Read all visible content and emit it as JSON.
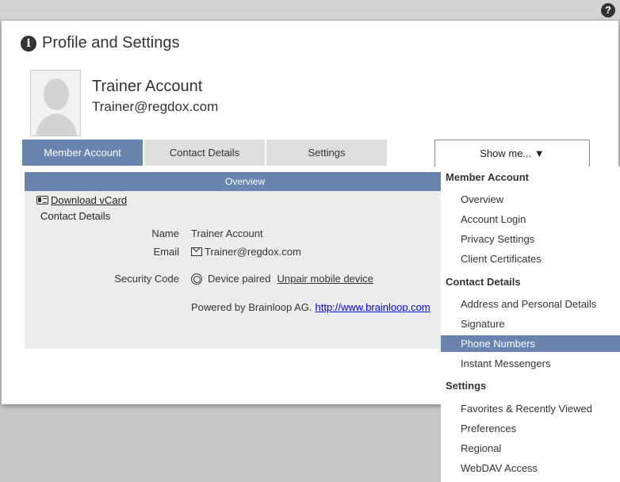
{
  "help_icon": "question-icon",
  "dialog": {
    "title": "Profile and Settings",
    "title_icon": "info-icon"
  },
  "user": {
    "name": "Trainer Account",
    "email": "Trainer@regdox.com"
  },
  "tabs": [
    {
      "label": "Member Account",
      "active": true
    },
    {
      "label": "Contact Details",
      "active": false
    },
    {
      "label": "Settings",
      "active": false
    }
  ],
  "show_me": {
    "label": "Show me... ▼"
  },
  "panel": {
    "header": "Overview",
    "vcard_label": "Download vCard",
    "section_label": "Contact Details",
    "name_label": "Name",
    "name_value": "Trainer Account",
    "email_label": "Email",
    "email_value": "Trainer@regdox.com",
    "security_label": "Security Code",
    "security_value": "Device paired",
    "unpair_label": "Unpair mobile device",
    "powered_by": "Powered by Brainloop AG.",
    "powered_link": "http://www.brainloop.com"
  },
  "menu": {
    "sections": [
      {
        "title": "Member Account",
        "items": [
          "Overview",
          "Account Login",
          "Privacy Settings",
          "Client Certificates"
        ]
      },
      {
        "title": "Contact Details",
        "items": [
          "Address and Personal Details",
          "Signature",
          "Phone Numbers",
          "Instant Messengers"
        ]
      },
      {
        "title": "Settings",
        "items": [
          "Favorites & Recently Viewed",
          "Preferences",
          "Regional",
          "WebDAV Access"
        ]
      }
    ],
    "highlighted": "Phone Numbers"
  },
  "colors": {
    "accent": "#6a84b0",
    "tab_inactive": "#dedede",
    "panel_bg": "#ececec",
    "backdrop": "#c7c7c7"
  }
}
